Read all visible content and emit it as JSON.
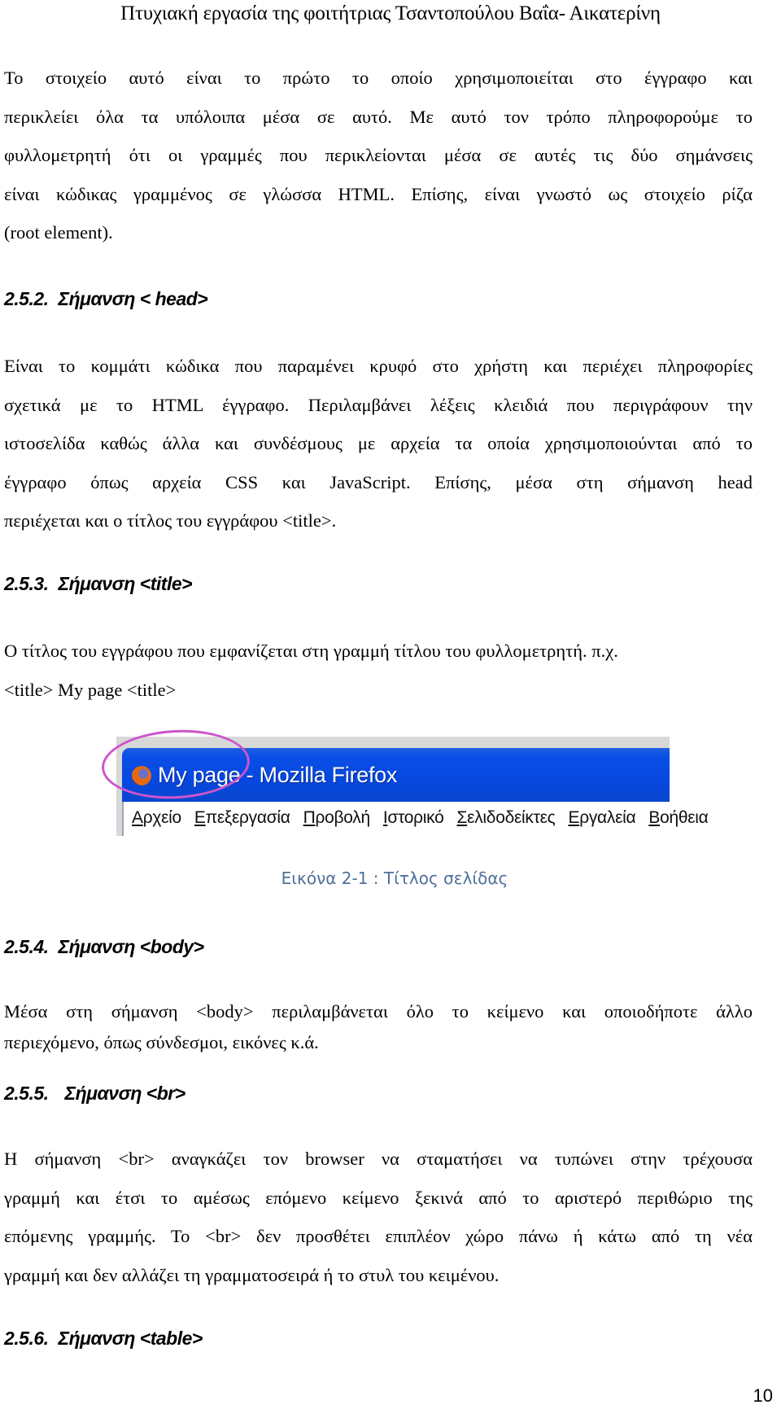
{
  "header": {
    "running_title": "Πτυχιακή εργασία της φοιτήτριας Τσαντοπούλου Βαΐα- Αικατερίνη"
  },
  "intro_paragraph": {
    "lines": [
      "Το στοιχείο αυτό είναι το πρώτο το οποίο χρησιμοποιείται στο έγγραφο και",
      "περικλείει όλα τα υπόλοιπα μέσα σε αυτό. Με αυτό τον τρόπο πληροφορούμε το",
      "φυλλομετρητή ότι οι γραμμές που περικλείονται μέσα σε αυτές τις δύο σημάνσεις",
      "είναι κώδικας γραμμένος σε γλώσσα HTML. Επίσης, είναι γνωστό ως στοιχείο ρίζα",
      "(root element)."
    ]
  },
  "sections": [
    {
      "number": "2.5.2.",
      "title": "Σήμανση < head>",
      "lines": [
        "Είναι το κομμάτι κώδικα που παραμένει κρυφό στο χρήστη και περιέχει πληροφορίες",
        "σχετικά με το HTML έγγραφο. Περιλαμβάνει λέξεις κλειδιά που περιγράφουν την",
        "ιστοσελίδα καθώς άλλα και συνδέσμους με αρχεία τα οποία χρησιμοποιούνται από το",
        "έγγραφο όπως αρχεία CSS και JavaScript. Επίσης, μέσα στη σήμανση head",
        "περιέχεται και ο τίτλος του εγγράφου <title>."
      ]
    },
    {
      "number": "2.5.3.",
      "title": "Σήμανση <title>",
      "lines": [
        "Ο τίτλος του εγγράφου που εμφανίζεται στη γραμμή τίτλου του φυλλομετρητή.  π.χ.",
        "<title> My page <title>"
      ]
    },
    {
      "number": "2.5.4.",
      "title": "Σήμανση <body>",
      "lines": [
        "Μέσα στη σήμανση <body> περιλαμβάνεται όλο το κείμενο και οποιοδήποτε άλλο",
        "περιεχόμενο, όπως σύνδεσμοι, εικόνες κ.ά."
      ]
    },
    {
      "number": "2.5.5.",
      "title": "Σήμανση <br>",
      "lines": [
        "Η σήμανση <br> αναγκάζει τον browser να σταματήσει να τυπώνει στην τρέχουσα",
        "γραμμή και έτσι το αμέσως επόμενο κείμενο ξεκινά από το αριστερό περιθώριο της",
        "επόμενης γραμμής. Το <br> δεν προσθέτει επιπλέον χώρο πάνω ή κάτω από τη νέα",
        "γραμμή και δεν αλλάζει τη γραμματοσειρά ή το στυλ του κειμένου."
      ]
    },
    {
      "number": "2.5.6.",
      "title": "Σήμανση <table>",
      "lines": []
    }
  ],
  "figure": {
    "window_title": "My page - Mozilla Firefox",
    "menu_items": [
      "Αρχείο",
      "Επεξεργασία",
      "Προβολή",
      "Ιστορικό",
      "Σελιδοδείκτες",
      "Εργαλεία",
      "Βοήθεια"
    ],
    "caption": "Εικόνα 2-1 : Τίτλος σελίδας",
    "colors": {
      "titlebar": "#0647df",
      "highlight_ellipse": "#cc55cc",
      "caption": "#4f6f9a"
    }
  },
  "footer": {
    "page_number": "10"
  }
}
